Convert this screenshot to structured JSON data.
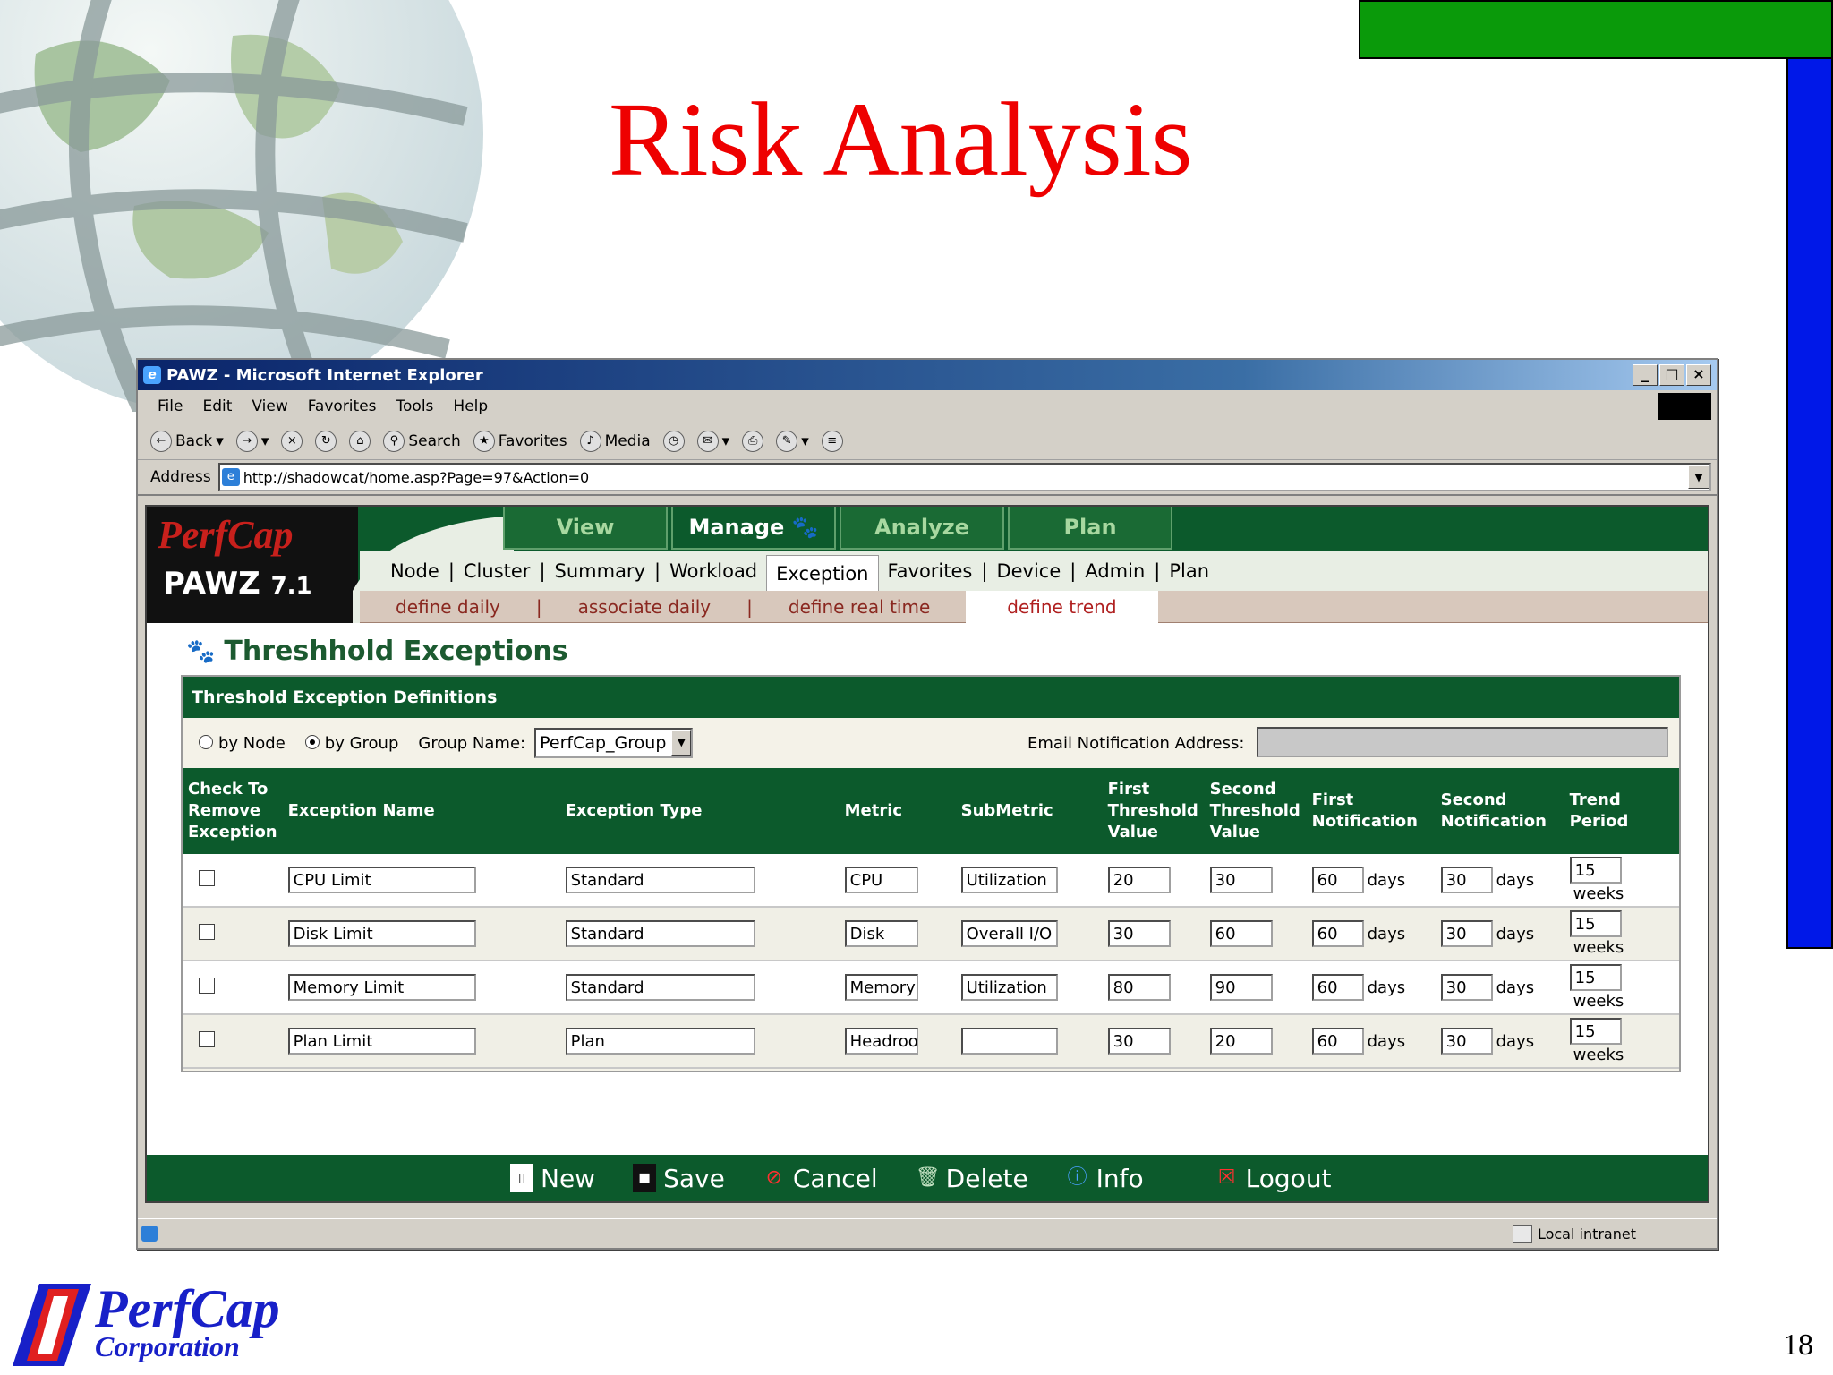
{
  "slide": {
    "title": "Risk Analysis",
    "page_number": "18",
    "logo_main": "PerfCap",
    "logo_sub": "Corporation"
  },
  "window": {
    "title": "PAWZ - Microsoft Internet Explorer",
    "menu": [
      "File",
      "Edit",
      "View",
      "Favorites",
      "Tools",
      "Help"
    ],
    "toolbar": {
      "back": "Back",
      "search": "Search",
      "favorites": "Favorites",
      "media": "Media"
    },
    "address_label": "Address",
    "url": "http://shadowcat/home.asp?Page=97&Action=0",
    "status_zone": "Local intranet"
  },
  "app": {
    "brand_logo": "PerfCap",
    "product": "PAWZ",
    "version": "7.1",
    "main_tabs": [
      "View",
      "Manage",
      "Analyze",
      "Plan"
    ],
    "active_main_tab": "Manage",
    "sub_nav": [
      "Node",
      "Cluster",
      "Summary",
      "Workload",
      "Exception",
      "Favorites",
      "Device",
      "Admin",
      "Plan"
    ],
    "active_sub_nav": "Exception",
    "trend_nav": [
      "define daily",
      "associate daily",
      "define real time",
      "define trend"
    ],
    "active_trend_nav": "define trend",
    "section_title": "Threshhold Exceptions",
    "panel_title": "Threshold Exception Definitions",
    "filter": {
      "by_node": "by Node",
      "by_group": "by Group",
      "selected": "by Group",
      "group_name_label": "Group Name:",
      "group_name_value": "PerfCap_Group",
      "email_label": "Email Notification Address:",
      "email_value": ""
    },
    "columns": [
      "Check To\nRemove\nException",
      "Exception Name",
      "Exception Type",
      "Metric",
      "SubMetric",
      "First\nThreshold\nValue",
      "Second\nThreshold\nValue",
      "First\nNotification",
      "Second\nNotification",
      "Trend\nPeriod"
    ],
    "rows": [
      {
        "name": "CPU Limit",
        "type": "Standard",
        "metric": "CPU",
        "submetric": "Utilization",
        "first_threshold": "20",
        "second_threshold": "30",
        "first_notification": "60",
        "second_notification": "30",
        "trend_period": "15"
      },
      {
        "name": "Disk Limit",
        "type": "Standard",
        "metric": "Disk",
        "submetric": "Overall I/O Rate",
        "first_threshold": "30",
        "second_threshold": "60",
        "first_notification": "60",
        "second_notification": "30",
        "trend_period": "15"
      },
      {
        "name": "Memory Limit",
        "type": "Standard",
        "metric": "Memory",
        "submetric": "Utilization",
        "first_threshold": "80",
        "second_threshold": "90",
        "first_notification": "60",
        "second_notification": "30",
        "trend_period": "15"
      },
      {
        "name": "Plan Limit",
        "type": "Plan",
        "metric": "Headroom",
        "submetric": "",
        "first_threshold": "30",
        "second_threshold": "20",
        "first_notification": "60",
        "second_notification": "30",
        "trend_period": "15"
      }
    ],
    "units": {
      "days": "days",
      "weeks": "weeks"
    },
    "actions": [
      "New",
      "Save",
      "Cancel",
      "Delete",
      "Info",
      "Logout"
    ]
  },
  "colors": {
    "title_red": "#ee0000",
    "app_green": "#0c5a2c",
    "slide_green": "#0a9a0a",
    "slide_blue": "#0018e8"
  }
}
